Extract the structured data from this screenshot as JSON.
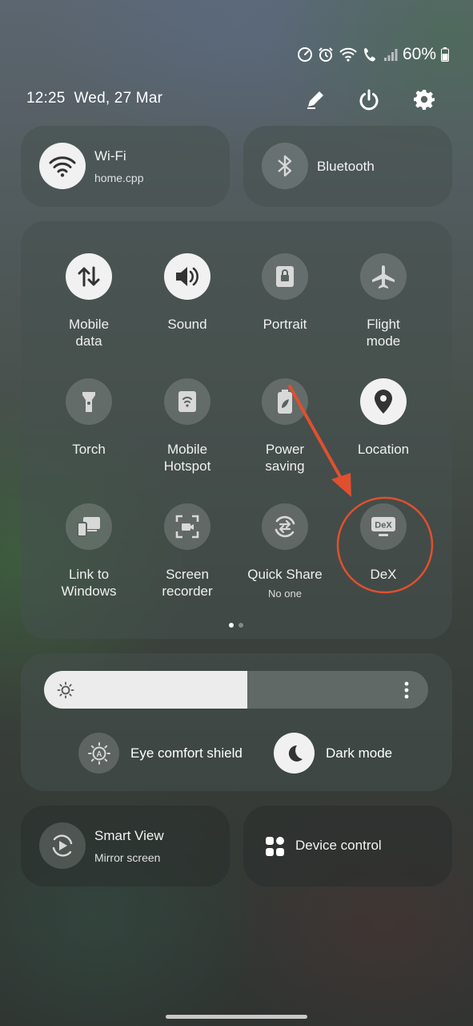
{
  "status_bar": {
    "battery_percent": "60%",
    "icons": [
      "data-saver-icon",
      "alarm-icon",
      "wifi-calling-icon",
      "volte-call-icon",
      "signal-icon",
      "battery-icon"
    ]
  },
  "header": {
    "time": "12:25",
    "date": "Wed, 27 Mar",
    "edit_icon": "pencil-icon",
    "power_icon": "power-icon",
    "settings_icon": "gear-icon"
  },
  "wifi": {
    "title": "Wi-Fi",
    "subtitle": "home.cpp",
    "state": "on"
  },
  "bluetooth": {
    "title": "Bluetooth",
    "state": "off"
  },
  "tiles": [
    {
      "label": "Mobile\ndata",
      "icon": "mobile-data-icon",
      "state": "on"
    },
    {
      "label": "Sound",
      "icon": "sound-icon",
      "state": "on"
    },
    {
      "label": "Portrait",
      "icon": "portrait-lock-icon",
      "state": "off"
    },
    {
      "label": "Flight\nmode",
      "icon": "airplane-icon",
      "state": "off"
    },
    {
      "label": "Torch",
      "icon": "torch-icon",
      "state": "off"
    },
    {
      "label": "Mobile\nHotspot",
      "icon": "hotspot-icon",
      "state": "off"
    },
    {
      "label": "Power\nsaving",
      "icon": "power-saving-icon",
      "state": "off"
    },
    {
      "label": "Location",
      "icon": "location-icon",
      "state": "on"
    },
    {
      "label": "Link to\nWindows",
      "icon": "link-windows-icon",
      "state": "off"
    },
    {
      "label": "Screen\nrecorder",
      "icon": "screen-recorder-icon",
      "state": "off"
    },
    {
      "label": "Quick Share",
      "sublabel": "No one",
      "icon": "quick-share-icon",
      "state": "off"
    },
    {
      "label": "DeX",
      "icon": "dex-icon",
      "state": "off",
      "icon_text": "DeX"
    }
  ],
  "pagination": {
    "current": 1,
    "total": 2
  },
  "brightness": {
    "level_fraction": 0.53,
    "menu_icon": "more-vertical-icon"
  },
  "eye_comfort": {
    "label": "Eye comfort shield",
    "state": "off"
  },
  "dark_mode": {
    "label": "Dark mode",
    "state": "on"
  },
  "smart_view": {
    "title": "Smart View",
    "subtitle": "Mirror screen"
  },
  "device_control": {
    "title": "Device control"
  },
  "annotation": {
    "color": "#e0502e",
    "target": "DeX"
  }
}
